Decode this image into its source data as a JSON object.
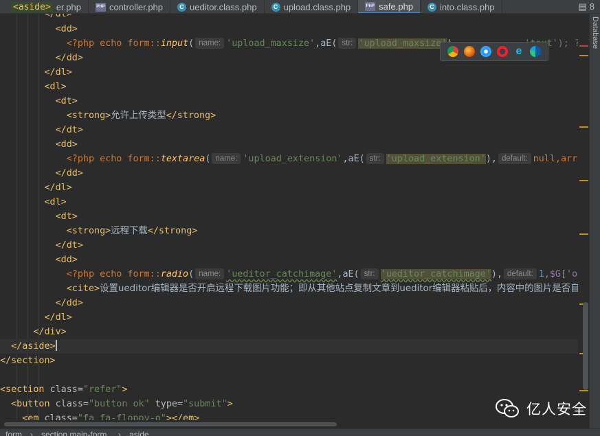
{
  "tabs": [
    {
      "label": "<aside>",
      "file": "er.php",
      "icon": "php-file-icon"
    },
    {
      "label": "controller.php",
      "icon": "php-file-icon"
    },
    {
      "label": "ueditor.class.php",
      "icon": "class-file-icon"
    },
    {
      "label": "upload.class.php",
      "icon": "class-file-icon"
    },
    {
      "label": "safe.php",
      "icon": "php-file-icon",
      "active": true
    },
    {
      "label": "into.class.php",
      "icon": "class-file-icon"
    }
  ],
  "tab_more_count": "8",
  "side_panel": "Database",
  "code": {
    "l1": "</dt>",
    "l2": "<dd>",
    "l3_pre": "<?php echo form::",
    "l3_fn": "input",
    "l3_h1": "name:",
    "l3_s1": "'upload_maxsize'",
    "l3_mid": ",aE(",
    "l3_h2": "str:",
    "l3_s2": "'upload_maxsize'",
    "l3_rest": "'text'); ?>",
    "l4": "</dd>",
    "l5": "</dl>",
    "l6": "<dl>",
    "l7": "<dt>",
    "l8_t1": "<strong>",
    "l8_txt": "允许上传类型",
    "l8_t2": "</strong>",
    "l9": "</dt>",
    "l10": "<dd>",
    "l11_fn": "textarea",
    "l11_s1": "'upload_extension'",
    "l11_s2": "'upload_extension'",
    "l11_h3": "default:",
    "l11_rest": "null,array(",
    "l12": "</dd>",
    "l13": "</dl>",
    "l14": "<dl>",
    "l15": "<dt>",
    "l16_txt": "远程下载",
    "l17": "</dt>",
    "l18": "<dd>",
    "l19_fn": "radio",
    "l19_s1": "'ueditor_catchimage'",
    "l19_s2": "'ueditor_catchimage'",
    "l19_rest_num": "1",
    "l19_rest": ",$G['optio",
    "l20_t1": "<cite>",
    "l20_txt": "设置ueditor编辑器是否开启远程下载图片功能；即从其他站点复制文章到ueditor编辑器粘贴后，内容中的图片是否自动下载",
    "l21": "</dd>",
    "l22": "</dl>",
    "l23": "</div>",
    "l24": "</aside>",
    "l25": "</section>",
    "l27_tag": "<section",
    "l27_attr": " class=",
    "l27_val": "\"refer\"",
    "l27_end": ">",
    "l28_tag": "<button",
    "l28_attr": " class=",
    "l28_val": "\"button ok\"",
    "l28_attr2": " type=",
    "l28_val2": "\"submit\"",
    "l28_end": ">",
    "l29_tag": "<em",
    "l29_attr": " class=",
    "l29_val": "\"fa fa-floppy-o\"",
    "l29_end": "></em>"
  },
  "breadcrumb": [
    "form",
    "section.main-form",
    "aside"
  ],
  "watermark": "亿人安全",
  "colors": {
    "accent": "#4a88c7",
    "tag": "#e8bf6a",
    "string": "#6a8759",
    "keyword": "#cc7832"
  }
}
